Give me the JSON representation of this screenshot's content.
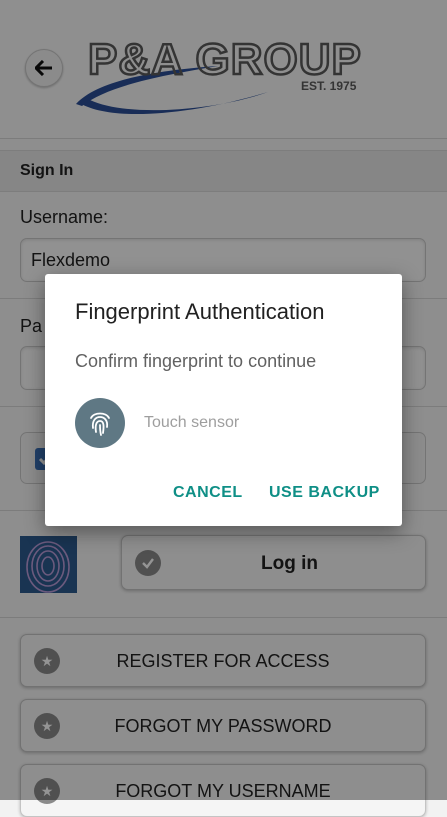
{
  "header": {
    "logo_text": "P&A GROUP",
    "logo_sub": "EST. 1975"
  },
  "section": {
    "title": "Sign In"
  },
  "form": {
    "username_label": "Username:",
    "username_value": "Flexdemo",
    "password_label": "Pa",
    "remember_checked": true
  },
  "login": {
    "label": "Log in"
  },
  "actions": [
    {
      "label": "REGISTER FOR ACCESS"
    },
    {
      "label": "FORGOT MY PASSWORD"
    },
    {
      "label": "FORGOT MY USERNAME"
    }
  ],
  "dialog": {
    "title": "Fingerprint Authentication",
    "message": "Confirm fingerprint to continue",
    "status": "Touch sensor",
    "cancel": "CANCEL",
    "backup": "USE BACKUP"
  },
  "colors": {
    "accent": "#0f8f86",
    "logo_blue": "#2b4f97",
    "logo_gray": "#5a5a5a"
  }
}
